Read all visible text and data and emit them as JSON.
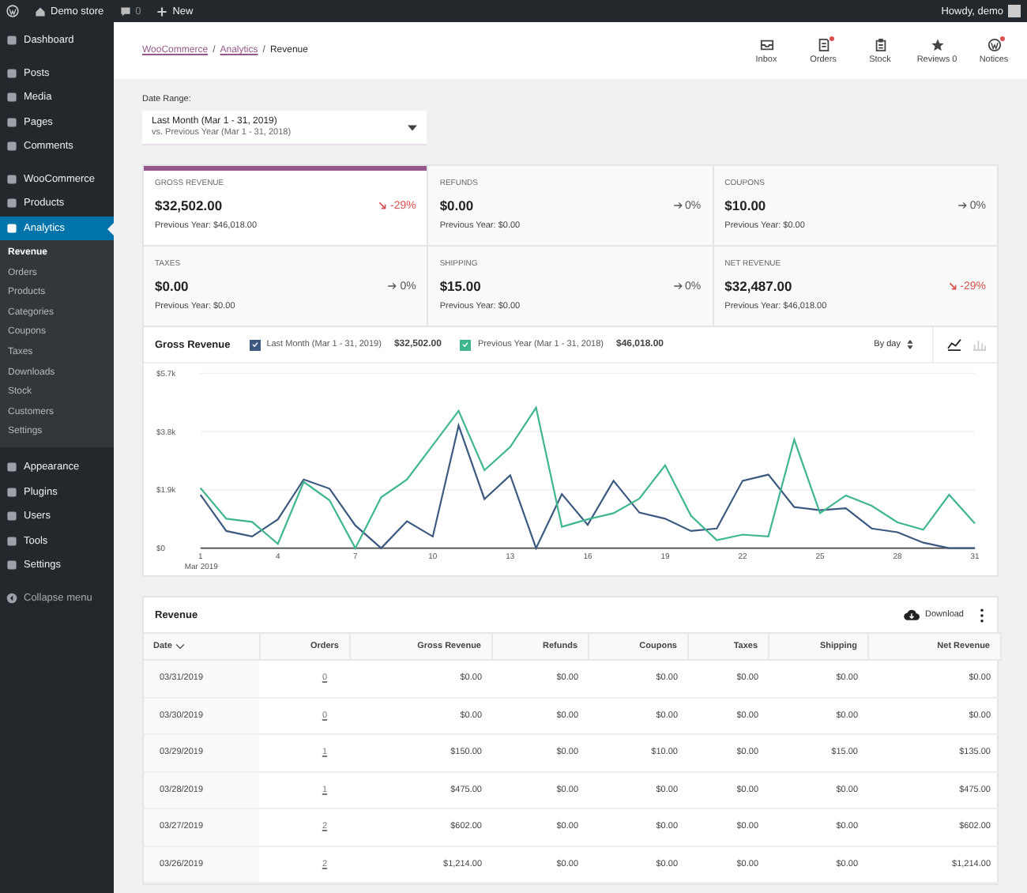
{
  "top_bar": {
    "site_name": "Demo store",
    "comments_count": "0",
    "new_label": "New",
    "greeting": "Howdy, demo"
  },
  "sidebar": {
    "groups": [
      {
        "items": [
          {
            "label": "Dashboard",
            "selected": false
          }
        ]
      },
      {
        "items": [
          {
            "label": "Posts",
            "selected": false
          },
          {
            "label": "Media",
            "selected": false
          },
          {
            "label": "Pages",
            "selected": false
          },
          {
            "label": "Comments",
            "selected": false
          }
        ]
      },
      {
        "items": [
          {
            "label": "WooCommerce",
            "selected": false
          },
          {
            "label": "Products",
            "selected": false
          },
          {
            "label": "Analytics",
            "selected": true,
            "children": [
              {
                "label": "Revenue",
                "selected": true
              },
              {
                "label": "Orders",
                "selected": false
              },
              {
                "label": "Products",
                "selected": false
              },
              {
                "label": "Categories",
                "selected": false
              },
              {
                "label": "Coupons",
                "selected": false
              },
              {
                "label": "Taxes",
                "selected": false
              },
              {
                "label": "Downloads",
                "selected": false
              },
              {
                "label": "Stock",
                "selected": false
              },
              {
                "label": "Customers",
                "selected": false
              },
              {
                "label": "Settings",
                "selected": false
              }
            ]
          }
        ]
      },
      {
        "items": [
          {
            "label": "Appearance",
            "selected": false
          },
          {
            "label": "Plugins",
            "selected": false
          },
          {
            "label": "Users",
            "selected": false
          },
          {
            "label": "Tools",
            "selected": false
          },
          {
            "label": "Settings",
            "selected": false
          }
        ]
      }
    ],
    "collapse_label": "Collapse menu"
  },
  "header": {
    "breadcrumb_separator": "/",
    "breadcrumbs": [
      {
        "label": "WooCommerce",
        "link": true
      },
      {
        "label": "Analytics",
        "link": true
      },
      {
        "label": "Revenue",
        "link": false
      }
    ],
    "activity": [
      {
        "label": "Inbox",
        "badge": false
      },
      {
        "label": "Orders",
        "badge": true
      },
      {
        "label": "Stock",
        "badge": false
      },
      {
        "label": "Reviews 0",
        "badge": false
      },
      {
        "label": "Notices",
        "badge": true
      }
    ]
  },
  "date_range": {
    "label": "Date Range:",
    "primary": "Last Month (Mar 1 - 31, 2019)",
    "secondary": "vs. Previous Year (Mar 1 - 31, 2018)"
  },
  "summary": [
    {
      "label": "GROSS REVENUE",
      "value": "$32,502.00",
      "delta": "-29%",
      "kind": "down",
      "previous": "Previous Year: $46,018.00",
      "selected": true
    },
    {
      "label": "REFUNDS",
      "value": "$0.00",
      "delta": "0%",
      "kind": "flat",
      "previous": "Previous Year: $0.00",
      "selected": false
    },
    {
      "label": "COUPONS",
      "value": "$10.00",
      "delta": "0%",
      "kind": "flat",
      "previous": "Previous Year: $0.00",
      "selected": false
    },
    {
      "label": "TAXES",
      "value": "$0.00",
      "delta": "0%",
      "kind": "flat",
      "previous": "Previous Year: $0.00",
      "selected": false
    },
    {
      "label": "SHIPPING",
      "value": "$15.00",
      "delta": "0%",
      "kind": "flat",
      "previous": "Previous Year: $0.00",
      "selected": false
    },
    {
      "label": "NET REVENUE",
      "value": "$32,487.00",
      "delta": "-29%",
      "kind": "down",
      "previous": "Previous Year: $46,018.00",
      "selected": false
    }
  ],
  "chart": {
    "title": "Gross Revenue",
    "interval": "By day",
    "month_label": "Mar 2019",
    "legend": [
      {
        "checked": true,
        "total": "$32,502.00"
      },
      {
        "checked": true,
        "total": "$46,018.00"
      }
    ],
    "view_modes": [
      {
        "kind": "line",
        "selected": true
      },
      {
        "kind": "bar",
        "selected": false
      }
    ],
    "chart_data": {
      "type": "line",
      "xlim": [
        1,
        31
      ],
      "ylim": [
        0,
        5700
      ],
      "x": [
        1,
        2,
        3,
        4,
        5,
        6,
        7,
        8,
        9,
        10,
        11,
        12,
        13,
        14,
        15,
        16,
        17,
        18,
        19,
        20,
        21,
        22,
        23,
        24,
        25,
        26,
        27,
        28,
        29,
        30,
        31
      ],
      "xticks": [
        1,
        4,
        7,
        10,
        13,
        16,
        19,
        22,
        25,
        28,
        31
      ],
      "yticks": [
        {
          "value": 0,
          "label": "$0"
        },
        {
          "value": 1900,
          "label": "$1.9k"
        },
        {
          "value": 3800,
          "label": "$3.8k"
        },
        {
          "value": 5700,
          "label": "$5.7k"
        }
      ],
      "series": [
        {
          "name": "Last Month (Mar 1 - 31, 2019)",
          "color": "#3c5a80",
          "values": [
            1740,
            560,
            380,
            940,
            2240,
            1940,
            740,
            0,
            880,
            380,
            4000,
            1600,
            2380,
            0,
            1760,
            760,
            2200,
            1160,
            960,
            560,
            640,
            2200,
            2400,
            1340,
            1240,
            1300,
            640,
            520,
            180,
            0,
            0
          ]
        },
        {
          "name": "Previous Year (Mar 1 - 31, 2018)",
          "color": "#3fb68f",
          "values": [
            1960,
            960,
            860,
            140,
            2160,
            1560,
            0,
            1660,
            2240,
            3360,
            4480,
            2540,
            3300,
            4580,
            700,
            940,
            1140,
            1620,
            2700,
            1060,
            260,
            440,
            380,
            3540,
            1140,
            1720,
            1380,
            840,
            600,
            1740,
            800
          ]
        }
      ]
    }
  },
  "table": {
    "title": "Revenue",
    "download_label": "Download",
    "columns": [
      {
        "label": "Date",
        "kind": "date",
        "sorted": true
      },
      {
        "label": "Orders",
        "kind": "link",
        "sorted": false
      },
      {
        "label": "Gross Revenue",
        "kind": "money",
        "sorted": false
      },
      {
        "label": "Refunds",
        "kind": "money",
        "sorted": false
      },
      {
        "label": "Coupons",
        "kind": "money",
        "sorted": false
      },
      {
        "label": "Taxes",
        "kind": "money",
        "sorted": false
      },
      {
        "label": "Shipping",
        "kind": "money",
        "sorted": false
      },
      {
        "label": "Net Revenue",
        "kind": "money",
        "sorted": false
      }
    ],
    "rows": [
      [
        "03/31/2019",
        "0",
        "$0.00",
        "$0.00",
        "$0.00",
        "$0.00",
        "$0.00",
        "$0.00"
      ],
      [
        "03/30/2019",
        "0",
        "$0.00",
        "$0.00",
        "$0.00",
        "$0.00",
        "$0.00",
        "$0.00"
      ],
      [
        "03/29/2019",
        "1",
        "$150.00",
        "$0.00",
        "$10.00",
        "$0.00",
        "$15.00",
        "$135.00"
      ],
      [
        "03/28/2019",
        "1",
        "$475.00",
        "$0.00",
        "$0.00",
        "$0.00",
        "$0.00",
        "$475.00"
      ],
      [
        "03/27/2019",
        "2",
        "$602.00",
        "$0.00",
        "$0.00",
        "$0.00",
        "$0.00",
        "$602.00"
      ],
      [
        "03/26/2019",
        "2",
        "$1,214.00",
        "$0.00",
        "$0.00",
        "$0.00",
        "$0.00",
        "$1,214.00"
      ]
    ]
  }
}
